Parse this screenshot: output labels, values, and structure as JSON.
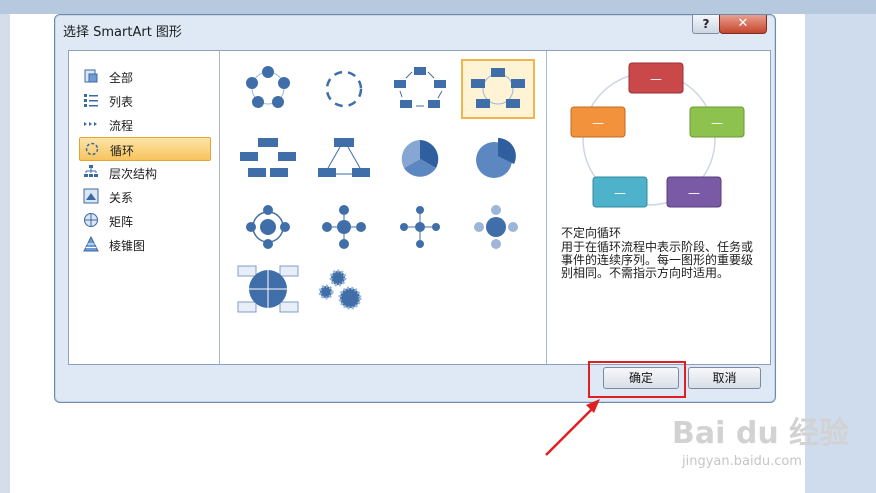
{
  "dialog": {
    "title": "选择 SmartArt 图形",
    "help_label": "?",
    "close_label": "✕",
    "ok_label": "确定",
    "cancel_label": "取消"
  },
  "categories": [
    {
      "label": "全部",
      "icon": "all-icon",
      "selected": false
    },
    {
      "label": "列表",
      "icon": "list-icon",
      "selected": false
    },
    {
      "label": "流程",
      "icon": "process-icon",
      "selected": false
    },
    {
      "label": "循环",
      "icon": "cycle-icon",
      "selected": true
    },
    {
      "label": "层次结构",
      "icon": "hierarchy-icon",
      "selected": false
    },
    {
      "label": "关系",
      "icon": "relationship-icon",
      "selected": false
    },
    {
      "label": "矩阵",
      "icon": "matrix-icon",
      "selected": false
    },
    {
      "label": "棱锥图",
      "icon": "pyramid-icon",
      "selected": false
    }
  ],
  "preview": {
    "name": "不定向循环",
    "description": "用于在循环流程中表示阶段、任务或事件的连续序列。每一图形的重要级别相同。不需指示方向时适用。",
    "box_label": "—",
    "colors": [
      "#c9494b",
      "#8ec24f",
      "#7a5aa4",
      "#4fb2cb",
      "#f2923c"
    ]
  },
  "watermark": {
    "logo": "Bai du 经验",
    "url": "jingyan.baidu.com"
  },
  "accent": {
    "selection": "#f8c35d",
    "highlight": "#e02020",
    "arrow": "#e02020"
  }
}
